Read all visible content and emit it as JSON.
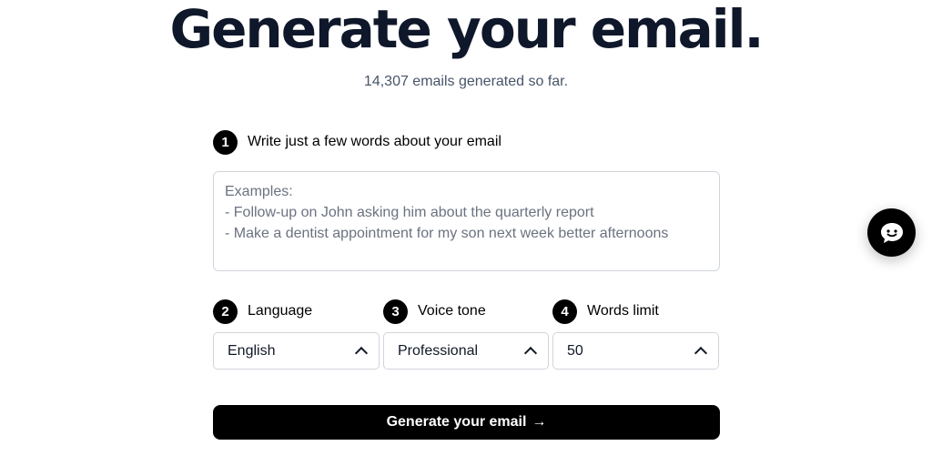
{
  "hero": {
    "title": "Generate your email.",
    "counter": "14,307 emails generated so far."
  },
  "steps": {
    "describe": {
      "number": "1",
      "label": "Write just a few words about your email",
      "placeholder": "Examples:\n- Follow-up on John asking him about the quarterly report\n- Make a dentist appointment for my son next week better afternoons"
    },
    "language": {
      "number": "2",
      "label": "Language",
      "selected": "English"
    },
    "tone": {
      "number": "3",
      "label": "Voice tone",
      "selected": "Professional"
    },
    "words": {
      "number": "4",
      "label": "Words limit",
      "selected": "50"
    }
  },
  "actions": {
    "generate_label": "Generate your email",
    "generate_arrow": "→"
  },
  "icons": {
    "chat": "chat-bubble-icon",
    "chevron": "chevron-up-icon"
  },
  "colors": {
    "primary": "#000000",
    "title": "#0f172a",
    "muted": "#475569",
    "border": "#d1d5db"
  }
}
